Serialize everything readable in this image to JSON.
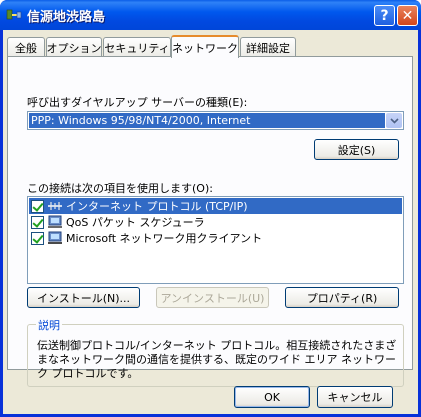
{
  "window": {
    "title": "信源地渋路島",
    "help_label": "?",
    "close_label": "✕"
  },
  "tabs": [
    {
      "label": "全般",
      "active": false
    },
    {
      "label": "オプション",
      "active": false
    },
    {
      "label": "セキュリティ",
      "active": false
    },
    {
      "label": "ネットワーク",
      "active": true
    },
    {
      "label": "詳細設定",
      "active": false
    }
  ],
  "dialup": {
    "label": "呼び出すダイヤルアップ サーバーの種類(E):",
    "selected_value": "PPP: Windows 95/98/NT4/2000, Internet",
    "settings_button": "設定(S)"
  },
  "components": {
    "label": "この接続は次の項目を使用します(O):",
    "items": [
      {
        "label": "インターネット プロトコル (TCP/IP)",
        "checked": true,
        "selected": true,
        "icon": "protocol-icon"
      },
      {
        "label": "QoS パケット スケジューラ",
        "checked": true,
        "selected": false,
        "icon": "service-icon"
      },
      {
        "label": "Microsoft ネットワーク用クライアント",
        "checked": true,
        "selected": false,
        "icon": "client-icon"
      }
    ],
    "install_button": "インストール(N)...",
    "uninstall_button": "アンインストール(U)",
    "properties_button": "プロパティ(R)"
  },
  "description": {
    "title": "説明",
    "text": "伝送制御プロトコル/インターネット プロトコル。相互接続されたさまざまなネットワーク間の通信を提供する、既定のワイド エリア ネットワーク プロトコルです。"
  },
  "footer": {
    "ok_button": "OK",
    "cancel_button": "キャンセル"
  }
}
